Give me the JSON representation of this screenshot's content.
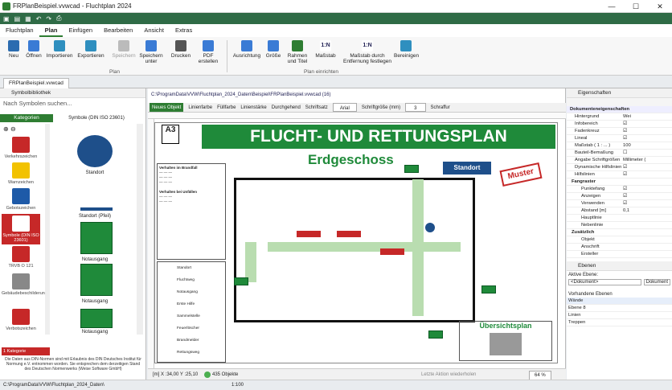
{
  "window": {
    "title": "FRPlanBeispiel.vvwcad - Fluchtplan 2024",
    "controls": [
      "—",
      "☐",
      "✕"
    ]
  },
  "menu": {
    "tabs": [
      "Fluchtplan",
      "Plan",
      "Einfügen",
      "Bearbeiten",
      "Ansicht",
      "Extras"
    ]
  },
  "ribbon": {
    "buttons": [
      "Neu",
      "Öffnen",
      "Importieren",
      "Exportieren",
      "Speichern",
      "Speichern unter",
      "Drucken",
      "PDF erstellen",
      "Ausrichtung",
      "Größe",
      "Rahmen und Titel",
      "Maßstab",
      "Maßstab durch Entfernung festlegen",
      "Bereinigen"
    ],
    "groups": [
      "Plan",
      "Plan einrichten"
    ]
  },
  "doctab": "FRPlanBeispiel.vvwcad",
  "left": {
    "header": "Symbolbibliothek",
    "search_placeholder": "Nach Symbolen suchen...",
    "kategorien_label": "Kategorien",
    "symbol_label": "Symbole (DIN ISO 23601)",
    "categories": [
      "Verkehrszeichen",
      "Warnzeichen",
      "Gebotszeichen",
      "Symbole (DIN ISO 23601)",
      "TRVB O 121",
      "Gebäudebeschilderung",
      "Verbotszeichen"
    ],
    "symbols": [
      "Standort",
      "Standort (Pfeil)",
      "Notausgang",
      "Notausgang",
      "Notausgang"
    ],
    "footer_warn": "1 Kategorie ausgeblen...",
    "footer_text": "Die Daten aus DIN-Normen sind mit Erlaubnis des DIN Deutsches Institut für Normung e.V. entnommen worden. Sie entsprechen dem derzeitigen Stand des Deutschen Normenwerks (Weise Software GmbH)"
  },
  "canvas": {
    "path": "C:\\ProgramData\\VVW\\Fluchtplan_2024_Daten\\Beispiel\\FRPlanBeispiel.vvwcad (16)",
    "toolbar": [
      "Neues Objekt",
      "Linienfarbe",
      "Füllfarbe",
      "Linienstärke",
      "Durchgehend",
      "Schriftsatz",
      "Arial",
      "Schriftgröße (mm)",
      "3",
      "Schraffur"
    ],
    "plan_title": "FLUCHT- UND RETTUNGSPLAN",
    "floor": "Erdgeschoss",
    "standort": "Standort",
    "muster": "Muster",
    "overview": "Übersichtsplan",
    "a3": "A3",
    "verhalten": "Verhalten im Brandfall",
    "unfall": "Verhalten bei Unfällen",
    "legend_items": [
      "Standort",
      "Fluchtweg",
      "Notausgang",
      "Erste Hilfe",
      "Sammelstelle",
      "Feuerlöscher",
      "Brandmelder",
      "Rettungsweg"
    ],
    "status_coords": "[m] X :34,00 Y :25,10",
    "status_objects": "435 Objekte",
    "undo": "Letzte Aktion wiederholen",
    "zoom": "64 %"
  },
  "right": {
    "header": "Eigenschaften",
    "section1": "Dokumenteneigenschaften",
    "props": [
      {
        "k": "Hintergrund",
        "v": "Wei"
      },
      {
        "k": "Infobereich",
        "v": "☑"
      },
      {
        "k": "Fadenkreuz",
        "v": "☑"
      },
      {
        "k": "Lineal",
        "v": "☑"
      },
      {
        "k": "Maßstab ( 1 : ... )",
        "v": "100"
      },
      {
        "k": "Bauteil-Bemaßung",
        "v": "☐"
      },
      {
        "k": "Angabe Schriftgrößen",
        "v": "Millimeter ("
      },
      {
        "k": "Dynamische Hilfslinien",
        "v": "☑"
      },
      {
        "k": "Hilfslinien",
        "v": "☑"
      }
    ],
    "section2": "Fangraster",
    "props2": [
      {
        "k": "Punktefang",
        "v": "☑"
      },
      {
        "k": "Anzeigen",
        "v": "☑"
      },
      {
        "k": "Verwenden",
        "v": "☑"
      },
      {
        "k": "Abstand [m]",
        "v": "0,1"
      },
      {
        "k": "Hauptlinie",
        "v": ""
      },
      {
        "k": "Nebenlinie",
        "v": ""
      }
    ],
    "section3": "Zusätzlich",
    "props3": [
      {
        "k": "Objekt",
        "v": ""
      },
      {
        "k": "Anschrift",
        "v": ""
      },
      {
        "k": "Ersteller",
        "v": ""
      }
    ],
    "layers_header": "Ebenen",
    "active_label": "Aktive Ebene:",
    "active_value": "<Dokument>",
    "active_btn": "Dokument",
    "existing": "Vorhandene Ebenen",
    "layers": [
      "Wände",
      "Ebene 8",
      "Linien",
      "Treppen"
    ]
  },
  "status": {
    "path": "C:\\ProgramData\\VVW\\Fluchtplan_2024_Daten\\",
    "scale": "1:100"
  }
}
